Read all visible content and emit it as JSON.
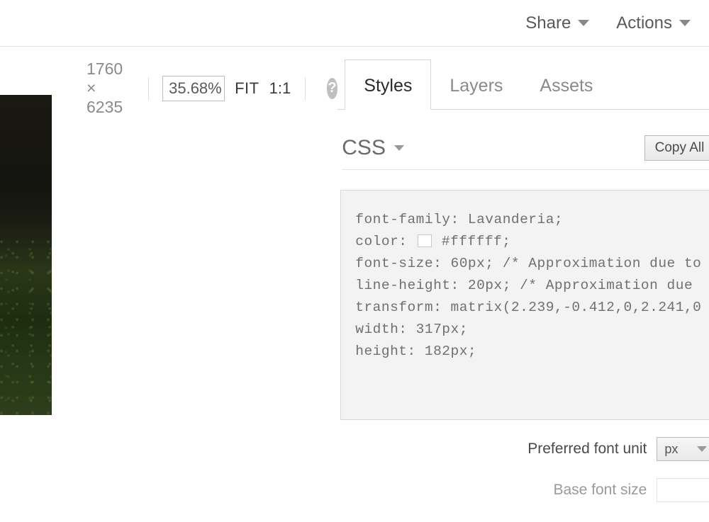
{
  "topbar": {
    "share": "Share",
    "actions": "Actions"
  },
  "dimbar": {
    "dimensions": "1760 × 6235",
    "zoom": "35.68%",
    "fit": "FIT",
    "oneone": "1:1"
  },
  "tabs": {
    "styles": "Styles",
    "layers": "Layers",
    "assets": "Assets"
  },
  "panel": {
    "css_label": "CSS",
    "copy_all": "Copy All",
    "code": {
      "line1": "font-family: Lavanderia;",
      "line2a": "color: ",
      "line2b": " #ffffff;",
      "line3": "font-size: 60px; /* Approximation due to",
      "line4": "line-height: 20px; /* Approximation due ",
      "line5": "transform: matrix(2.239,-0.412,0,2.241,0",
      "line6": "width: 317px;",
      "line7": "height: 182px;"
    },
    "pref_unit_label": "Preferred font unit",
    "pref_unit_value": "px",
    "base_size_label": "Base font size"
  }
}
